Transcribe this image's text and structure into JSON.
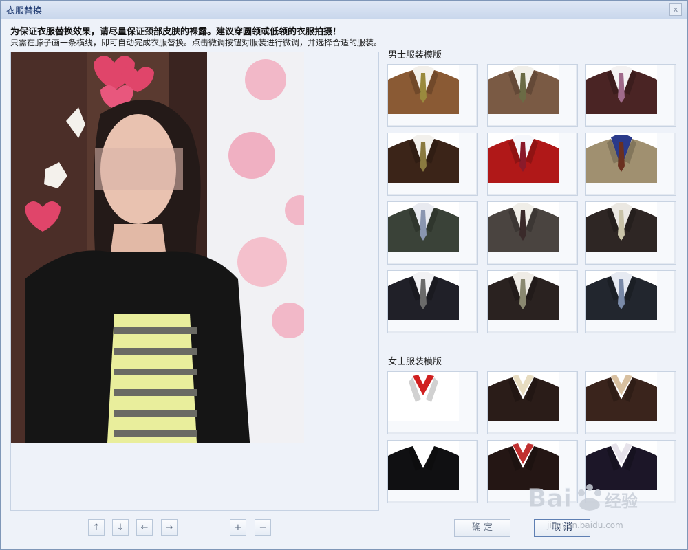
{
  "window": {
    "title": "衣服替换",
    "close_glyph": "x"
  },
  "notice": "为保证衣服替换效果，请尽量保证颈部皮肤的裸露。建议穿圆领或低领的衣服拍摄！",
  "hint": "只需在脖子画一条横线，即可自动完成衣服替换。点击微调按钮对服装进行微调，并选择合适的服装。",
  "men_section": {
    "title": "男士服装模版"
  },
  "women_section": {
    "title": "女士服装模版"
  },
  "nudge_buttons": {
    "up": "↑",
    "down": "↓",
    "left": "←",
    "right": "→",
    "plus": "+",
    "minus": "−"
  },
  "buttons": {
    "ok": "确  定",
    "cancel": "取  消"
  },
  "watermark": {
    "text": "jingyan.baidu.com"
  },
  "colors": {
    "accent": "#5e7fb3",
    "window_bg": "#eef2f9",
    "title_text": "#1e3970"
  },
  "men_templates": [
    {
      "suit": "#8a5a34",
      "shirt": "#f3f0ea",
      "tie": "#9a8a3d"
    },
    {
      "suit": "#7a5a44",
      "shirt": "#f1efe9",
      "tie": "#6b6b45"
    },
    {
      "suit": "#4a2424",
      "shirt": "#f4f2f2",
      "tie": "#a06a8a"
    },
    {
      "suit": "#3b2418",
      "shirt": "#f2f0ec",
      "tie": "#8a7a40"
    },
    {
      "suit": "#b01818",
      "shirt": "#f5f7fb",
      "tie": "#8a1a2a"
    },
    {
      "suit": "#a09070",
      "shirt": "#2a3a8a",
      "tie": "#6a3020"
    },
    {
      "suit": "#3a4238",
      "shirt": "#e8eaf0",
      "tie": "#8a96b0"
    },
    {
      "suit": "#4a4440",
      "shirt": "#f0eee8",
      "tie": "#3a2a2a"
    },
    {
      "suit": "#2e2624",
      "shirt": "#ebe8e2",
      "tie": "#c9c3a8"
    },
    {
      "suit": "#202028",
      "shirt": "#f2f2f4",
      "tie": "#6a6a6a"
    },
    {
      "suit": "#2a2220",
      "shirt": "#efece6",
      "tie": "#8a8870"
    },
    {
      "suit": "#22262e",
      "shirt": "#e6eaf2",
      "tie": "#7a8aa8"
    }
  ],
  "women_templates": [
    {
      "suit": "#ffffff",
      "shirt": "#d02020",
      "tie": ""
    },
    {
      "suit": "#2a1c18",
      "shirt": "#e7dcc0",
      "tie": ""
    },
    {
      "suit": "#3a241c",
      "shirt": "#d8c0a0",
      "tie": ""
    },
    {
      "suit": "#101012",
      "shirt": "#ffffff",
      "tie": ""
    },
    {
      "suit": "#241614",
      "shirt": "#c03030",
      "tie": ""
    },
    {
      "suit": "#1c1628",
      "shirt": "#e6e2ea",
      "tie": ""
    }
  ]
}
